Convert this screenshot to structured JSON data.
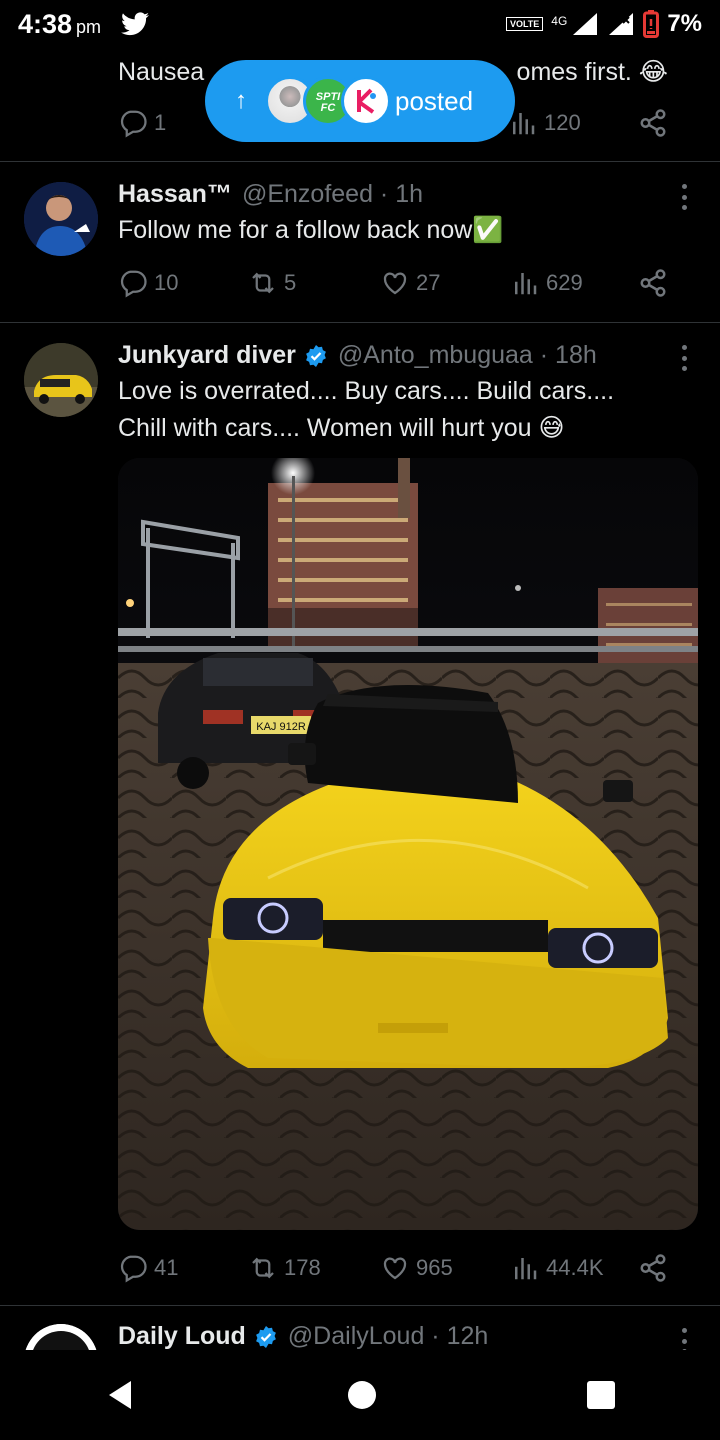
{
  "status_bar": {
    "time": "4:38",
    "ampm": "pm",
    "volte": "VOLTE",
    "network": "4G",
    "battery": "7%"
  },
  "posted_pill": {
    "label": "posted"
  },
  "tweet_partial": {
    "text_left": "Nausea",
    "text_right": "omes first. 😂",
    "reply_count": "1",
    "view_count": "120"
  },
  "tweet_hassan": {
    "name": "Hassan™",
    "handle": "@Enzofeed · 1h",
    "text": "Follow me for a follow back now✅",
    "replies": "10",
    "retweets": "5",
    "likes": "27",
    "views": "629"
  },
  "tweet_junkyard": {
    "name": "Junkyard diver",
    "handle": "@Anto_mbuguaa · 18h",
    "text_line1": "Love is overrated.... Buy cars.... Build cars....",
    "text_line2": "Chill with cars.... Women will hurt you 😅",
    "plate": "KAJ 912R",
    "replies": "41",
    "retweets": "178",
    "likes": "965",
    "views": "44.4K"
  },
  "tweet_dailyloud": {
    "name": "Daily Loud",
    "handle": "@DailyLoud · 12h"
  },
  "colors": {
    "accent": "#1d9bf0",
    "muted": "#71767b",
    "car_yellow": "#e8c51a"
  },
  "icons": [
    "twitter-icon",
    "signal-icon",
    "battery-icon",
    "reply-icon",
    "retweet-icon",
    "like-icon",
    "views-icon",
    "share-icon",
    "more-icon",
    "verified-icon",
    "back-icon",
    "home-icon",
    "recents-icon"
  ]
}
